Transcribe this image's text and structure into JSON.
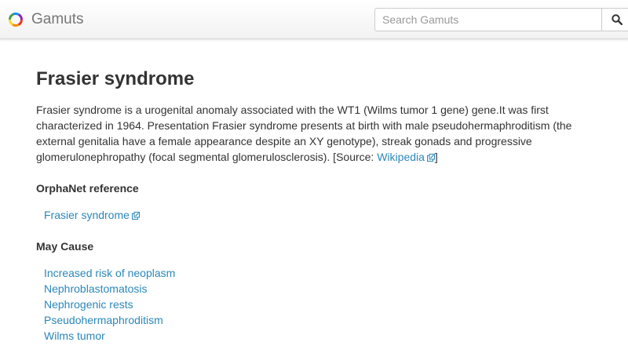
{
  "navbar": {
    "brand": "Gamuts",
    "search": {
      "placeholder": "Search Gamuts",
      "value": ""
    },
    "search_button_icon": "search-icon"
  },
  "page": {
    "title": "Frasier syndrome",
    "description": "Frasier syndrome is a urogenital anomaly associated with the WT1 (Wilms tumor 1 gene) gene.It was first characterized in 1964. Presentation Frasier syndrome presents at birth with male pseudohermaphroditism (the external genitalia have a female appearance despite an XY genotype), streak gonads and progressive glomerulonephropathy (focal segmental glomerulosclerosis). [Source: ",
    "source_link": "Wikipedia",
    "source_close": "]",
    "orphanet": {
      "heading": "OrphaNet reference",
      "link": "Frasier syndrome"
    },
    "may_cause": {
      "heading": "May Cause",
      "items": [
        "Increased risk of neoplasm",
        "Nephroblastomatosis",
        "Nephrogenic rests",
        "Pseudohermaphroditism",
        "Wilms tumor"
      ]
    }
  },
  "colors": {
    "link": "#2a87b8",
    "text": "#333333",
    "brand_text": "#777777"
  }
}
